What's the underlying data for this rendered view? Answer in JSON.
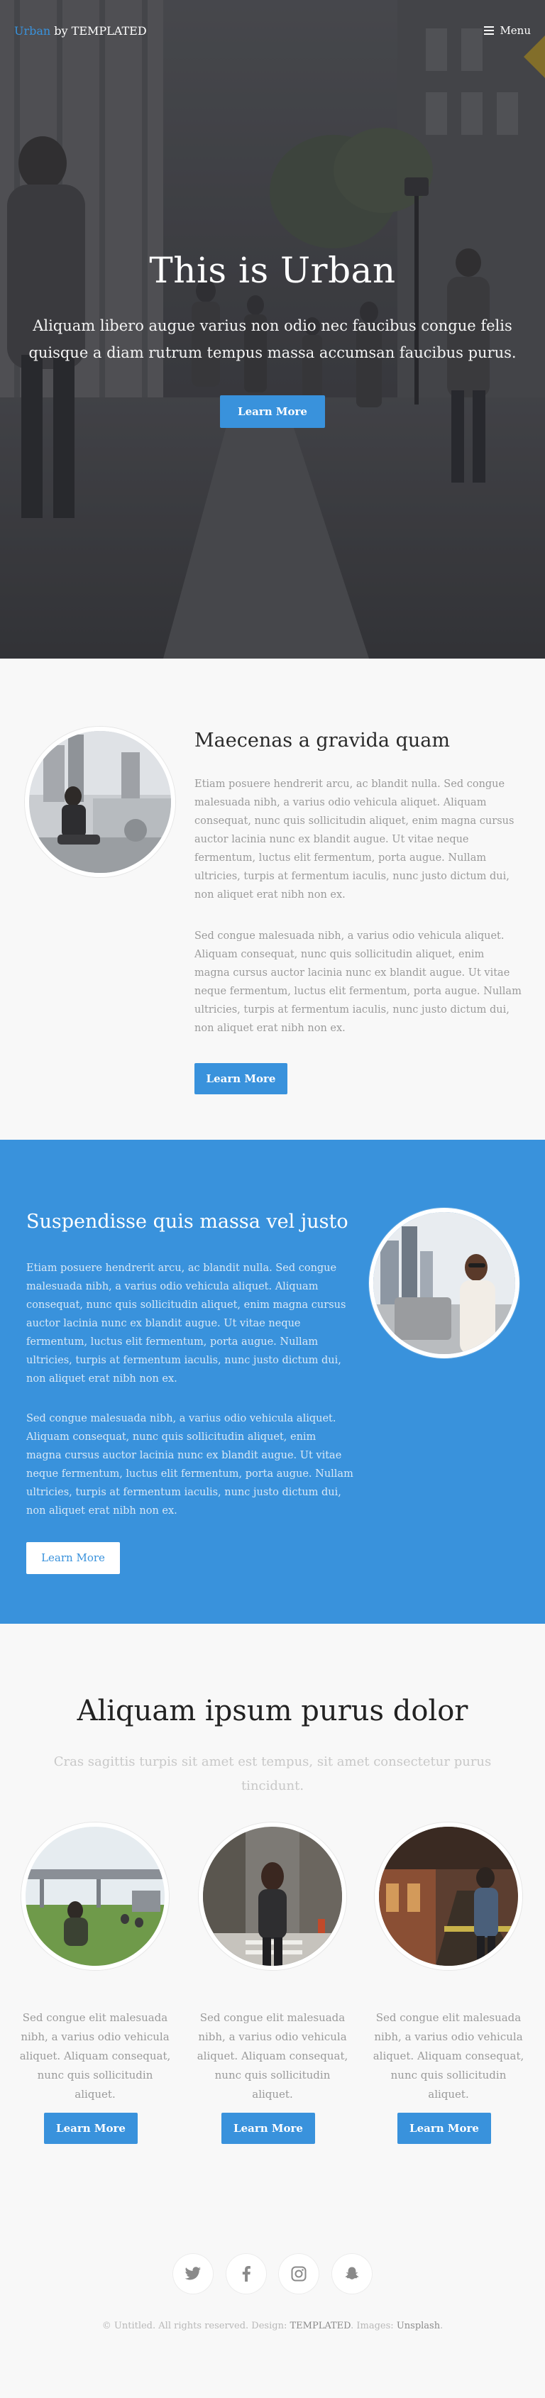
{
  "header": {
    "logo_brand": "Urban",
    "logo_rest": " by TEMPLATED",
    "menu_label": "Menu"
  },
  "hero": {
    "title": "This is Urban",
    "text": "Aliquam libero augue varius non odio nec faucibus congue felis quisque a diam rutrum tempus massa accumsan faucibus purus.",
    "button_label": "Learn More"
  },
  "section_one": {
    "heading": "Maecenas a gravida quam",
    "paragraph_1": "Etiam posuere hendrerit arcu, ac blandit nulla. Sed congue malesuada nibh, a varius odio vehicula aliquet. Aliquam consequat, nunc quis sollicitudin aliquet, enim magna cursus auctor lacinia nunc ex blandit augue. Ut vitae neque fermentum, luctus elit fermentum, porta augue. Nullam ultricies, turpis at fermentum iaculis, nunc justo dictum dui, non aliquet erat nibh non ex.",
    "paragraph_2": "Sed congue malesuada nibh, a varius odio vehicula aliquet. Aliquam consequat, nunc quis sollicitudin aliquet, enim magna cursus auctor lacinia nunc ex blandit augue. Ut vitae neque fermentum, luctus elit fermentum, porta augue. Nullam ultricies, turpis at fermentum iaculis, nunc justo dictum dui, non aliquet erat nibh non ex.",
    "button_label": "Learn More"
  },
  "section_two": {
    "heading": "Suspendisse quis massa vel justo",
    "paragraph_1": "Etiam posuere hendrerit arcu, ac blandit nulla. Sed congue malesuada nibh, a varius odio vehicula aliquet. Aliquam consequat, nunc quis sollicitudin aliquet, enim magna cursus auctor lacinia nunc ex blandit augue. Ut vitae neque fermentum, luctus elit fermentum, porta augue. Nullam ultricies, turpis at fermentum iaculis, nunc justo dictum dui, non aliquet erat nibh non ex.",
    "paragraph_2": "Sed congue malesuada nibh, a varius odio vehicula aliquet. Aliquam consequat, nunc quis sollicitudin aliquet, enim magna cursus auctor lacinia nunc ex blandit augue. Ut vitae neque fermentum, luctus elit fermentum, porta augue. Nullam ultricies, turpis at fermentum iaculis, nunc justo dictum dui, non aliquet erat nibh non ex.",
    "button_label": "Learn More"
  },
  "section_three": {
    "heading": "Aliquam ipsum purus dolor",
    "subtitle": "Cras sagittis turpis sit amet est tempus, sit amet consectetur purus tincidunt.",
    "cards": [
      {
        "text": "Sed congue elit malesuada nibh, a varius odio vehicula aliquet. Aliquam consequat, nunc quis sollicitudin aliquet.",
        "button_label": "Learn More"
      },
      {
        "text": "Sed congue elit malesuada nibh, a varius odio vehicula aliquet. Aliquam consequat, nunc quis sollicitudin aliquet.",
        "button_label": "Learn More"
      },
      {
        "text": "Sed congue elit malesuada nibh, a varius odio vehicula aliquet. Aliquam consequat, nunc quis sollicitudin aliquet.",
        "button_label": "Learn More"
      }
    ]
  },
  "footer": {
    "socials": [
      "twitter-icon",
      "facebook-icon",
      "instagram-icon",
      "snapchat-icon"
    ],
    "copyright_prefix": "© Untitled. All rights reserved. Design: ",
    "design_link": "TEMPLATED",
    "images_prefix": ". Images: ",
    "images_link": "Unsplash",
    "copyright_suffix": "."
  },
  "colors": {
    "accent": "#3992dc",
    "heading_dark": "#222222",
    "body_text": "#9a9a9a"
  }
}
